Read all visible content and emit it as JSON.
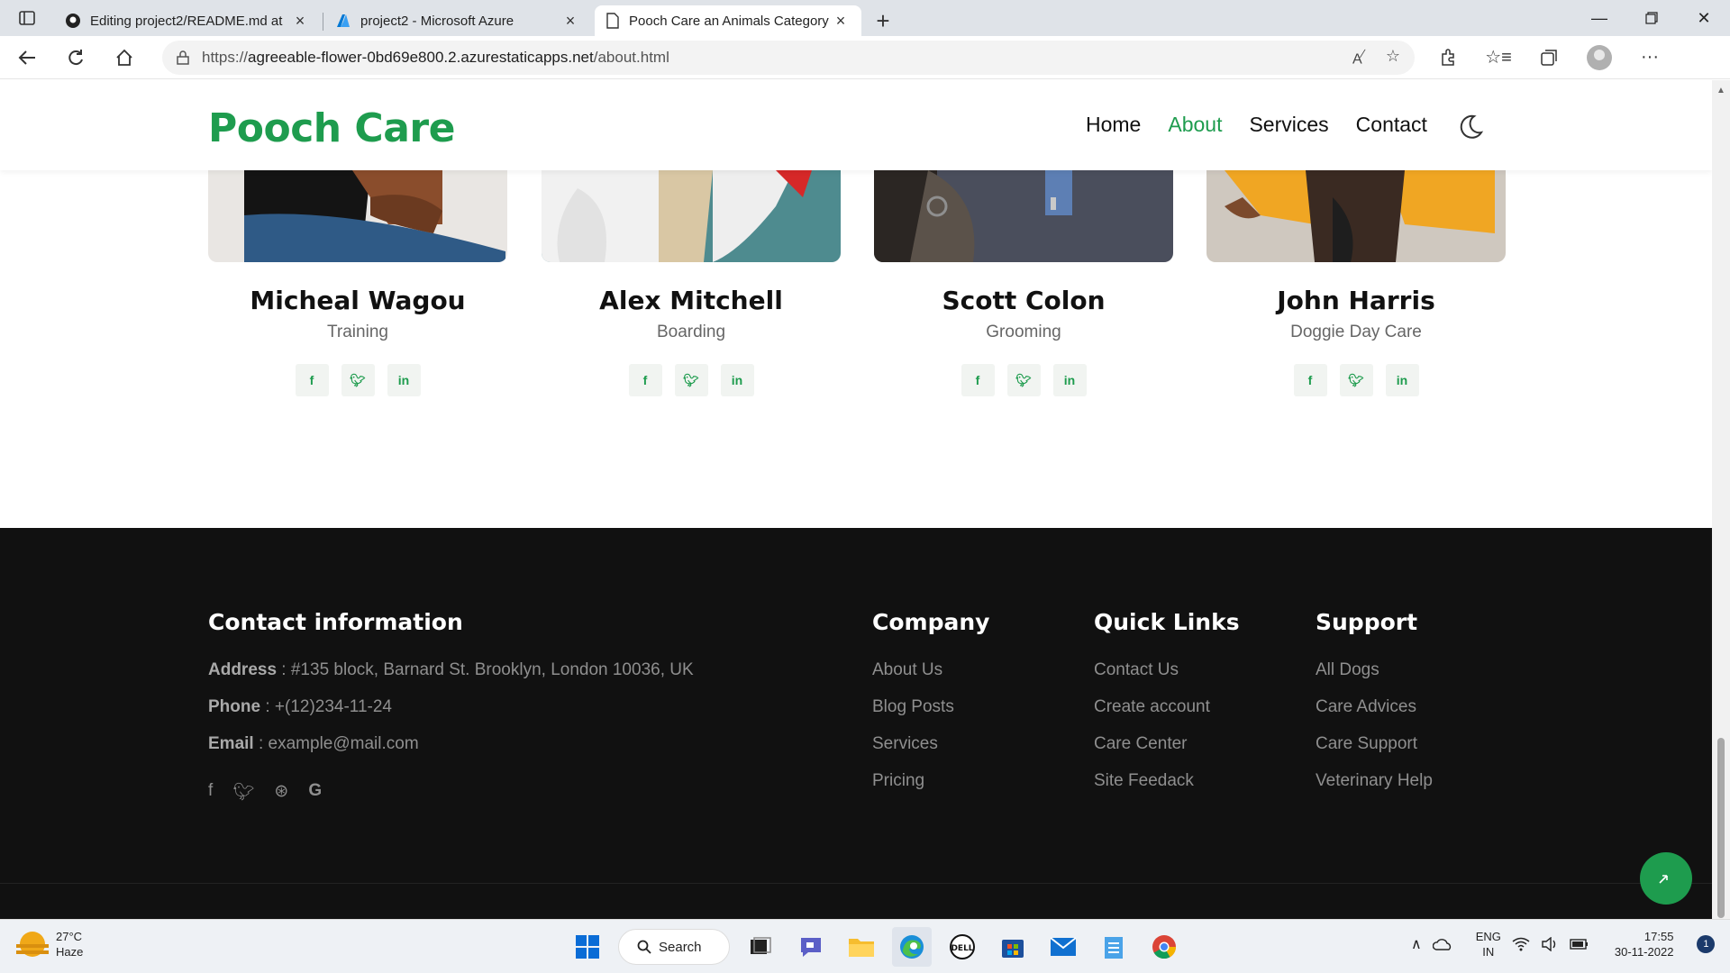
{
  "browser": {
    "tabs": [
      {
        "title": "Editing project2/README.md at",
        "icon": "github-icon",
        "active": false
      },
      {
        "title": "project2 - Microsoft Azure",
        "icon": "azure-icon",
        "active": false
      },
      {
        "title": "Pooch Care an Animals Category",
        "icon": "page-icon",
        "active": true
      }
    ],
    "url_prefix": "https://",
    "url_host": "agreeable-flower-0bd69e800.2.azurestaticapps.net",
    "url_path": "/about.html"
  },
  "site": {
    "logo": "Pooch Care",
    "nav": [
      {
        "label": "Home",
        "active": false
      },
      {
        "label": "About",
        "active": true
      },
      {
        "label": "Services",
        "active": false
      },
      {
        "label": "Contact",
        "active": false
      }
    ],
    "accent_color": "#1e9c4e"
  },
  "team": [
    {
      "name": "Micheal Wagou",
      "role": "Training"
    },
    {
      "name": "Alex Mitchell",
      "role": "Boarding"
    },
    {
      "name": "Scott Colon",
      "role": "Grooming"
    },
    {
      "name": "John Harris",
      "role": "Doggie Day Care"
    }
  ],
  "footer": {
    "contact_heading": "Contact information",
    "address_label": "Address",
    "address_value": " : #135 block, Barnard St. Brooklyn, London 10036, UK",
    "phone_label": "Phone",
    "phone_value": " : +(12)234-11-24",
    "email_label": "Email",
    "email_value": " : example@mail.com",
    "company": {
      "heading": "Company",
      "links": [
        "About Us",
        "Blog Posts",
        "Services",
        "Pricing"
      ]
    },
    "quick": {
      "heading": "Quick Links",
      "links": [
        "Contact Us",
        "Create account",
        "Care Center",
        "Site Feedack"
      ]
    },
    "support": {
      "heading": "Support",
      "links": [
        "All Dogs",
        "Care Advices",
        "Care Support",
        "Veterinary Help"
      ]
    }
  },
  "taskbar": {
    "temperature": "27°C",
    "weather": "Haze",
    "search_label": "Search",
    "lang_top": "ENG",
    "lang_bottom": "IN",
    "time": "17:55",
    "date": "30-11-2022",
    "notifications": "1"
  }
}
